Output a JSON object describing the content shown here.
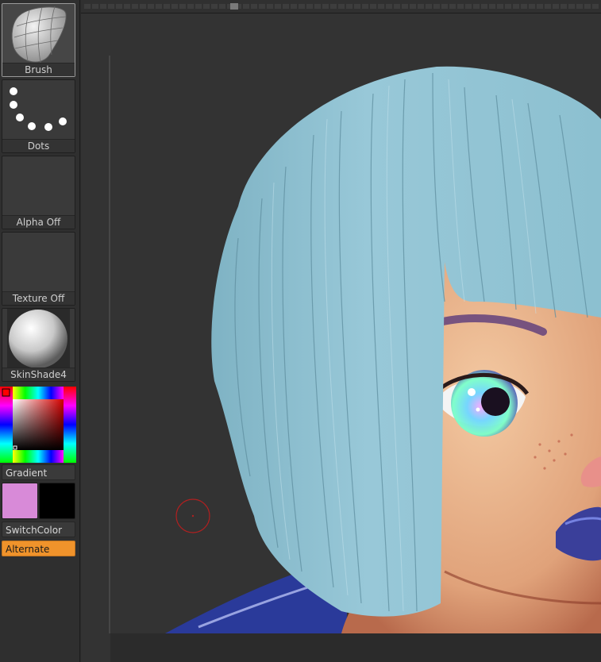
{
  "shelf": {
    "brush": {
      "label": "Brush",
      "icon": "brush-icon"
    },
    "stroke": {
      "label": "Dots",
      "icon": "dots-stroke-icon"
    },
    "alpha": {
      "label": "Alpha Off"
    },
    "texture": {
      "label": "Texture Off"
    },
    "material": {
      "label": "SkinShade4",
      "icon": "material-sphere-icon"
    },
    "gradient_label": "Gradient",
    "main_color": "#d88ad8",
    "secondary_color": "#000000",
    "switch_color_label": "SwitchColor",
    "alternate_label": "Alternate",
    "alternate_color": "#f0932b"
  },
  "colors": {
    "background": "#2b2b2b",
    "canvas": "#333333",
    "hair": "#8fc2d2",
    "skin": "#e8b48e",
    "lips": "#3a3f9a",
    "cursor": "#b02020"
  }
}
